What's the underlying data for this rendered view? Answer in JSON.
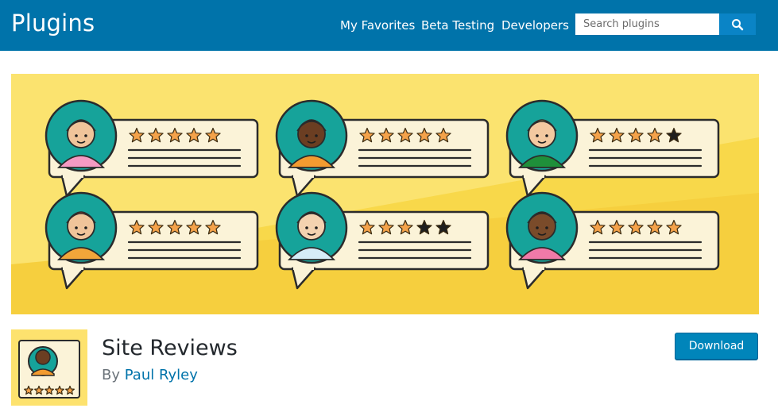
{
  "header": {
    "title": "Plugins",
    "nav": [
      "My Favorites",
      "Beta Testing",
      "Developers"
    ],
    "search_placeholder": "Search plugins"
  },
  "banner": {
    "reviews": [
      {
        "rating": 5
      },
      {
        "rating": 5
      },
      {
        "rating": 4
      },
      {
        "rating": 5
      },
      {
        "rating": 3
      },
      {
        "rating": 5
      }
    ]
  },
  "plugin": {
    "name": "Site Reviews",
    "by_label": "By",
    "author": "Paul Ryley",
    "download_label": "Download"
  },
  "colors": {
    "header_bg": "#0073aa",
    "banner_bg": "#f8d84a",
    "star": "#f4a24a",
    "star_empty": "#1f1f1f",
    "button": "#0085ba"
  }
}
